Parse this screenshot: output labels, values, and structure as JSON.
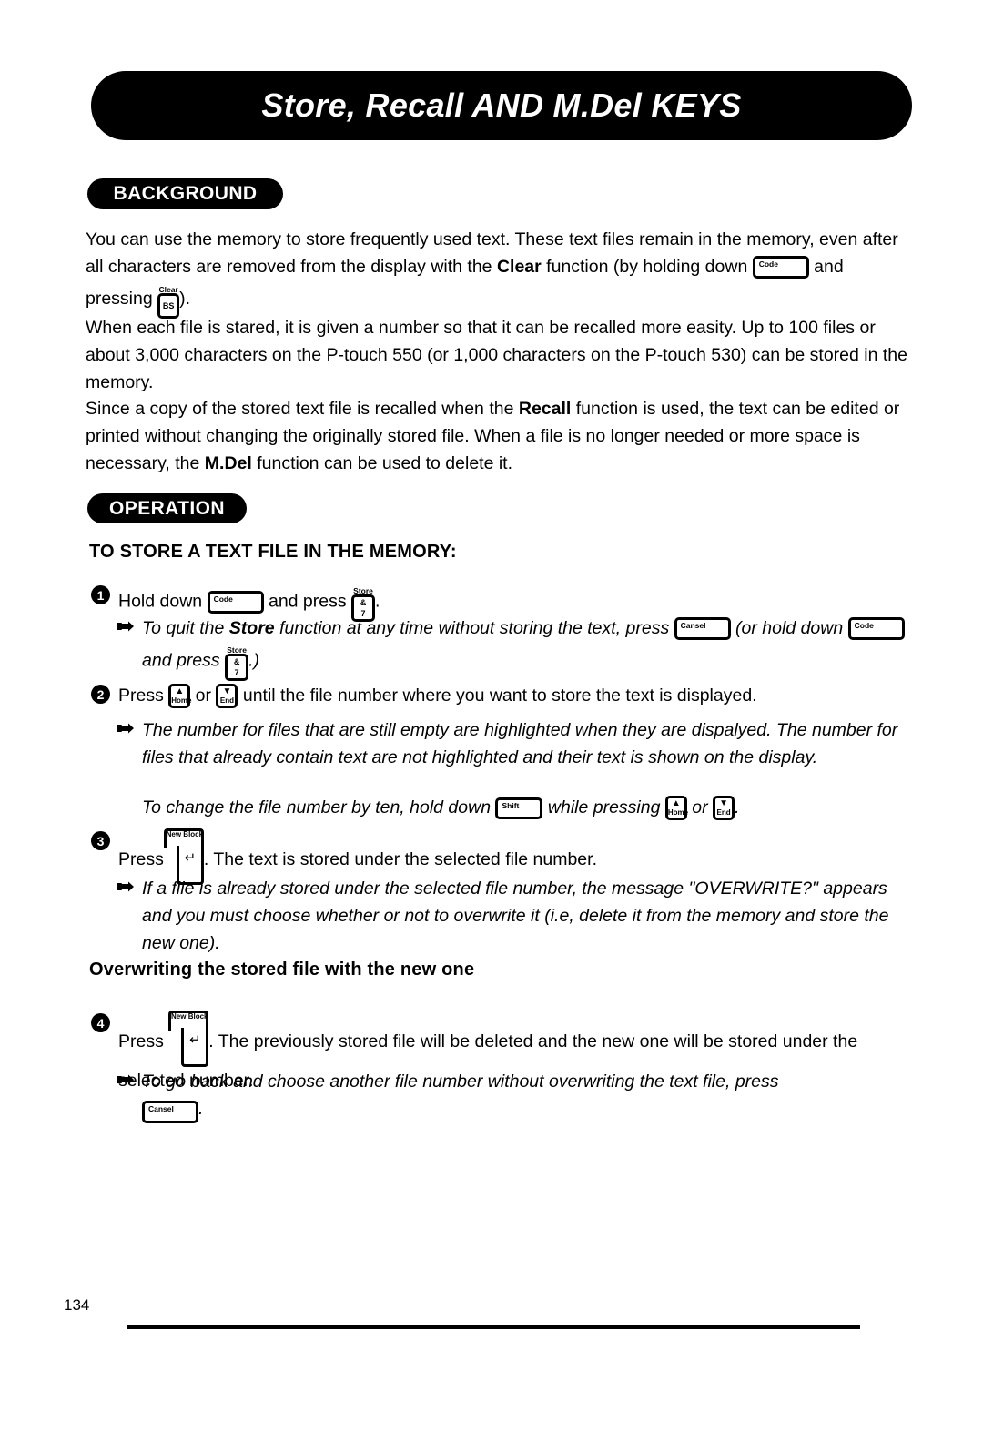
{
  "document": {
    "title": "Store, Recall AND M.Del KEYS",
    "page_number": "134"
  },
  "sections": {
    "background": {
      "badge": "BACKGROUND",
      "paragraph_1": {
        "part_a": "You can use the memory to store frequently used text.  These text files remain in the memory, even after all characters are removed from the display with the ",
        "bold_1": "Clear",
        "part_b": " function (by holding down ",
        "part_c": " and pressing ",
        "part_d": ")."
      },
      "paragraph_2": "When each file is stared, it is given a number so that it can be recalled more easity. Up to 100 files or about 3,000 characters on the P-touch 550 (or 1,000 characters on the P-touch 530) can be stored in the memory.",
      "paragraph_3": {
        "part_a": "Since a copy of the stored text file is recalled when the ",
        "bold_1": "Recall",
        "part_b": " function is used, the text can be edited or printed without changing the originally stored file.  When a file is no longer needed or more space is necessary, the ",
        "bold_2": "M.Del",
        "part_c": " function can be used to delete it."
      }
    },
    "operation": {
      "badge": "OPERATION",
      "heading": "TO STORE A TEXT FILE IN THE MEMORY:",
      "subheading": "Overwriting the stored file with the new one",
      "steps": [
        {
          "number": "1",
          "text_a": "Hold down ",
          "text_b": " and press ",
          "text_c": "."
        },
        {
          "number": "2",
          "text_a": "Press ",
          "text_b": " or ",
          "text_c": " until the file number where you want to store the text is displayed."
        },
        {
          "number": "3",
          "text_a": "Press",
          "text_b": ".  The text is stored under the selected file number."
        },
        {
          "number": "4",
          "text_a": "Press ",
          "text_b": ".  The previously stored file will be deleted and the new one will be stored under the selected number."
        }
      ],
      "notes": {
        "note_1": {
          "part_a": "To quit the ",
          "bold_1": "Store",
          "part_b": " function at any time without storing the text, press ",
          "part_c": " (or hold down ",
          "part_d": " and press ",
          "part_e": ".)"
        },
        "note_2": "The number for files that are still empty are highlighted when they are dispalyed.  The number for files that already contain text are not highlighted and their text is shown on the display.",
        "note_3": {
          "part_a": "To change the file number by ten, hold down ",
          "part_b": " while pressing ",
          "part_c": " or ",
          "part_d": "."
        },
        "note_4": "If a file is already stored under the selected file number, the message \"OVERWRITE?\" appears and you must choose whether or not to overwrite it (i.e, delete it from the memory and store the new one).",
        "note_5": {
          "part_a": "To go back and choose another file number without overwriting the text file, press ",
          "part_b": "."
        }
      }
    }
  },
  "keys": {
    "code": {
      "label": "Code"
    },
    "shift": {
      "label": "Shift"
    },
    "cancel": {
      "label": "Cansel"
    },
    "bs_clear": {
      "cap": "Clear",
      "label": "BS"
    },
    "store_7": {
      "cap": "Store",
      "top": "&",
      "bottom": "7"
    },
    "home": {
      "arrow": "▲",
      "label": "Home"
    },
    "end": {
      "arrow": "▼",
      "label": "End"
    },
    "new_block_return": {
      "label": "New Block",
      "arrow": "↵"
    }
  },
  "markers": {
    "hand": "☞"
  }
}
